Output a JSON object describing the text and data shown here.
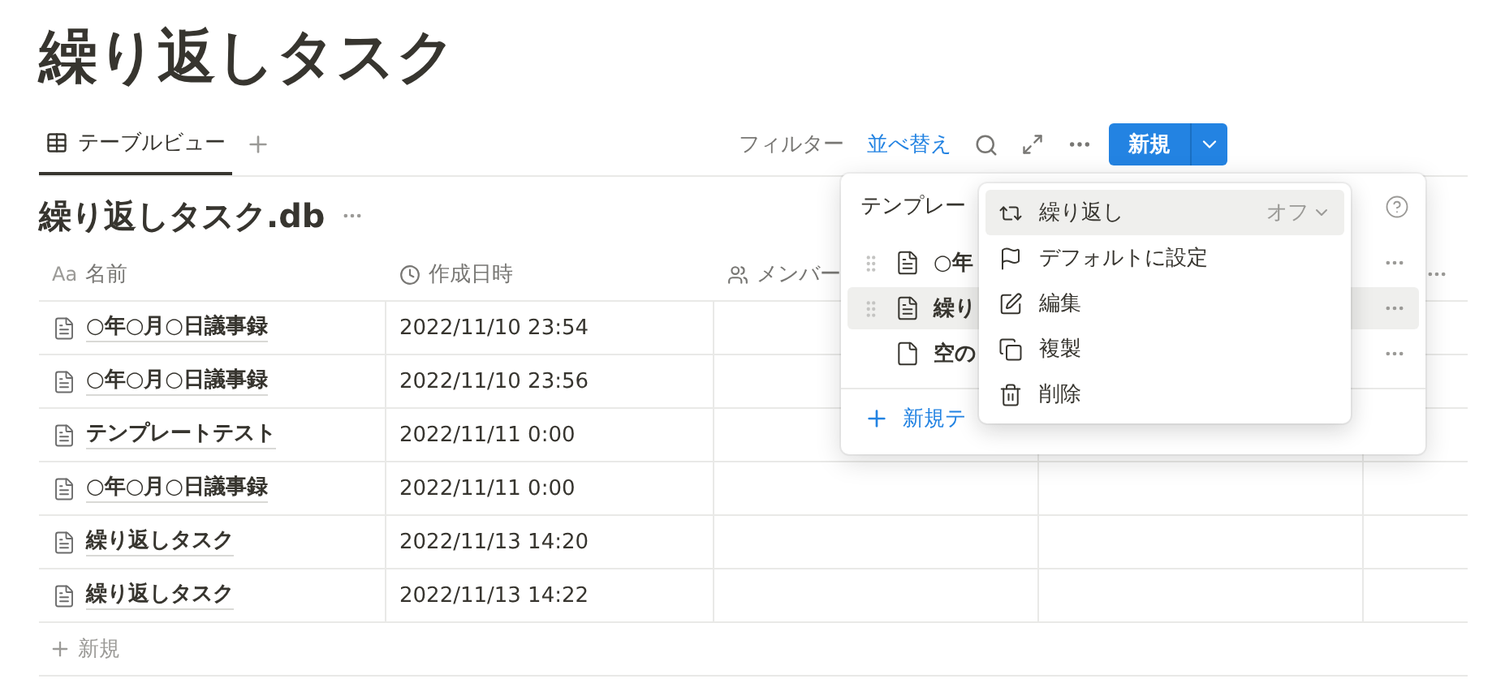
{
  "page_title": "繰り返しタスク",
  "tabs": [
    {
      "label": "テーブルビュー",
      "selected": true
    }
  ],
  "toolbar": {
    "filter": "フィルター",
    "sort": {
      "label": "並べ替え",
      "active": true
    },
    "new_button": "新規"
  },
  "database": {
    "title": "繰り返しタスク.db",
    "columns": [
      {
        "label": "名前",
        "kind": "title",
        "prefix": "Aa"
      },
      {
        "label": "作成日時",
        "kind": "created"
      },
      {
        "label": "メンバー",
        "kind": "person"
      }
    ],
    "rows": [
      {
        "name": "○年○月○日議事録",
        "created": "2022/11/10 23:54"
      },
      {
        "name": "○年○月○日議事録",
        "created": "2022/11/10 23:56"
      },
      {
        "name": "テンプレートテスト",
        "created": "2022/11/11 0:00"
      },
      {
        "name": "○年○月○日議事録",
        "created": "2022/11/11 0:00"
      },
      {
        "name": "繰り返しタスク",
        "created": "2022/11/13 14:20"
      },
      {
        "name": "繰り返しタスク",
        "created": "2022/11/13 14:22"
      }
    ],
    "add_row": "新規"
  },
  "template_popover": {
    "title": "テンプレー",
    "items": [
      {
        "name": "○年",
        "kind": "filled",
        "selected": false
      },
      {
        "name": "繰り",
        "kind": "filled",
        "selected": true
      },
      {
        "name": "空の",
        "kind": "blank",
        "selected": false
      }
    ],
    "new_template": "新規テ"
  },
  "context_menu": {
    "items": [
      {
        "label": "繰り返し",
        "kind": "repeat",
        "selected": true,
        "value": "オフ"
      },
      {
        "label": "デフォルトに設定",
        "kind": "flag",
        "selected": false
      },
      {
        "label": "編集",
        "kind": "edit",
        "selected": false
      },
      {
        "label": "複製",
        "kind": "copy",
        "selected": false
      },
      {
        "label": "削除",
        "kind": "trash",
        "selected": false
      }
    ]
  }
}
